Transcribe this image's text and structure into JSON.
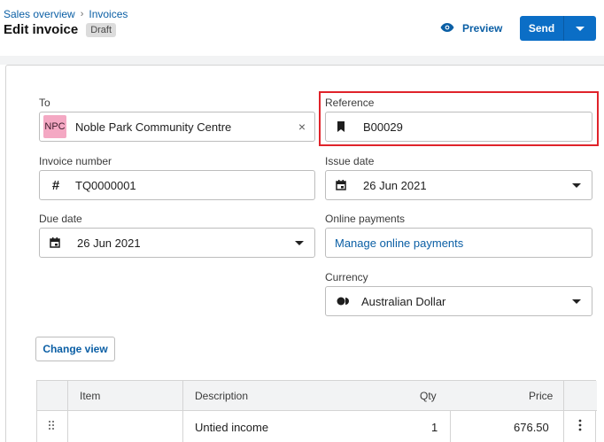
{
  "breadcrumb": {
    "items": [
      "Sales overview",
      "Invoices"
    ],
    "separator": "›"
  },
  "header": {
    "title": "Edit invoice",
    "status_badge": "Draft"
  },
  "actions": {
    "preview_label": "Preview",
    "send_label": "Send"
  },
  "form": {
    "to": {
      "label": "To",
      "avatar_initials": "NPC",
      "value": "Noble Park Community Centre",
      "clear_icon": "×"
    },
    "reference": {
      "label": "Reference",
      "value": "B00029"
    },
    "invoice_number": {
      "label": "Invoice number",
      "value": "TQ0000001"
    },
    "issue_date": {
      "label": "Issue date",
      "value": "26 Jun 2021"
    },
    "due_date": {
      "label": "Due date",
      "value": "26 Jun 2021"
    },
    "online_payments": {
      "label": "Online payments",
      "value": "Manage online payments"
    },
    "currency": {
      "label": "Currency",
      "value": "Australian Dollar"
    }
  },
  "change_view_label": "Change view",
  "table": {
    "columns": [
      "Item",
      "Description",
      "Qty",
      "Price"
    ],
    "rows": [
      {
        "item": "",
        "description": "Untied income",
        "qty": "1",
        "price": "676.50"
      }
    ]
  },
  "colors": {
    "accent": "#0b6ec6",
    "link": "#0b5fa5",
    "highlight": "#e0232a",
    "avatar": "#f4a8c3"
  },
  "icons": [
    "eye-icon",
    "chevron-down-icon",
    "close-icon",
    "bookmark-icon",
    "hash-icon",
    "calendar-icon",
    "currency-icon",
    "drag-handle-icon",
    "more-vertical-icon"
  ]
}
